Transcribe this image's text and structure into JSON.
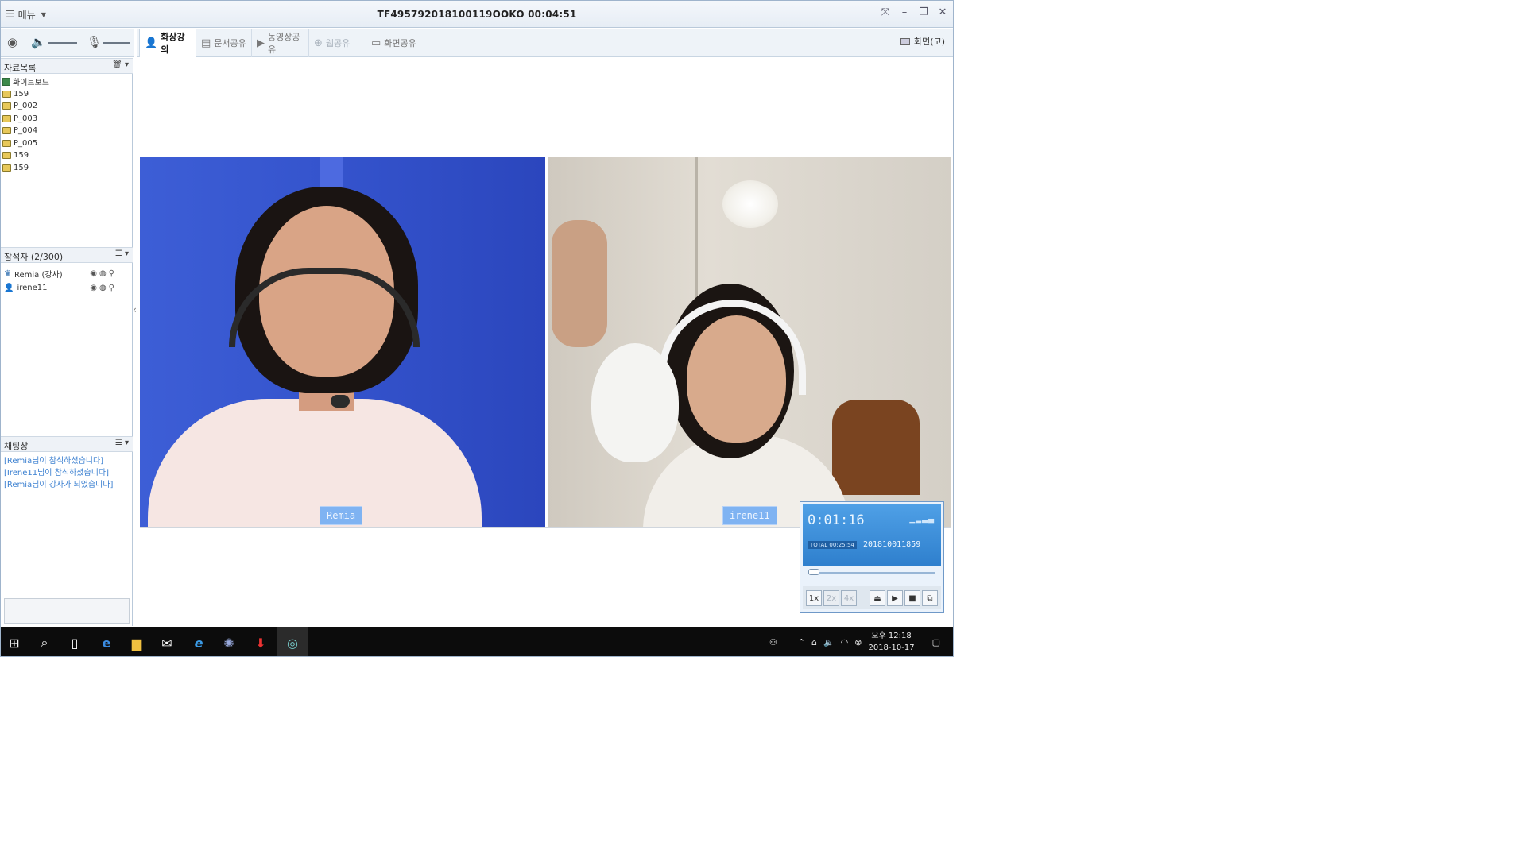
{
  "window": {
    "menu_label": "메뉴",
    "title": "TF495792018100119OOKO 00:04:51"
  },
  "tabs": [
    {
      "label": "화상강의",
      "state": "active"
    },
    {
      "label": "문서공유",
      "state": "normal"
    },
    {
      "label": "동영상공유",
      "state": "normal"
    },
    {
      "label": "웹공유",
      "state": "disabled"
    },
    {
      "label": "화면공유",
      "state": "normal"
    }
  ],
  "view_button": "화면(고)",
  "left": {
    "materials_title": "자료목록",
    "files": [
      "화이트보드",
      "159",
      "P_002",
      "P_003",
      "P_004",
      "P_005",
      "159",
      "159"
    ],
    "participants_title": "참석자 (2/300)",
    "participants": [
      {
        "name": "Remia (강사)",
        "role": "instructor"
      },
      {
        "name": "irene11",
        "role": "student"
      }
    ],
    "chat_title": "채팅창",
    "chat_messages": [
      "[Remia님이 참석하셨습니다]",
      "[Irene11님이 참석하셨습니다]",
      "[Remia님이 강사가 되었습니다]"
    ]
  },
  "videos": {
    "left_name": "Remia",
    "right_name": "irene11"
  },
  "player": {
    "time": "0:01:16",
    "total_label": "TOTAL 00:25:54",
    "timestamp": "201810011859",
    "speeds": [
      "1x",
      "2x",
      "4x"
    ],
    "selected_speed": "1x"
  },
  "taskbar": {
    "clock_time": "오후 12:18",
    "clock_date": "2018-10-17"
  },
  "colors": {
    "accent": "#7fb3f2",
    "chat_text": "#3a7fd0",
    "taskbar": "#0c0c0c"
  }
}
